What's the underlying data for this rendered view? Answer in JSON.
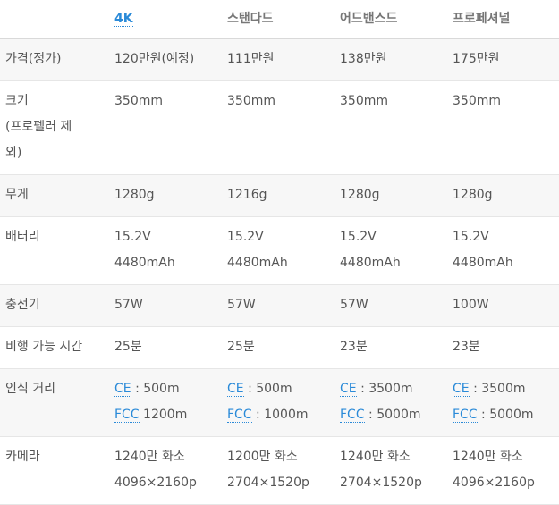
{
  "header": {
    "blank": "",
    "col1": "4K",
    "col2": "스탠다드",
    "col3": "어드밴스드",
    "col4": "프로페셔널"
  },
  "rows": {
    "price": {
      "label": "가격(정가)",
      "v1": "120만원(예정)",
      "v2": "111만원",
      "v3": "138만원",
      "v4": "175만원"
    },
    "size": {
      "label_line1": "크기",
      "label_line2": "(프로펠러 제",
      "label_line3": "외)",
      "v1": "350mm",
      "v2": "350mm",
      "v3": "350mm",
      "v4": "350mm"
    },
    "weight": {
      "label": "무게",
      "v1": "1280g",
      "v2": "1216g",
      "v3": "1280g",
      "v4": "1280g"
    },
    "battery": {
      "label": "배터리",
      "v1_line1": "15.2V",
      "v1_line2": "4480mAh",
      "v2_line1": "15.2V",
      "v2_line2": "4480mAh",
      "v3_line1": "15.2V",
      "v3_line2": "4480mAh",
      "v4_line1": "15.2V",
      "v4_line2": "4480mAh"
    },
    "charger": {
      "label": "충전기",
      "v1": "57W",
      "v2": "57W",
      "v3": "57W",
      "v4": "100W"
    },
    "flight_time": {
      "label": "비행 가능 시간",
      "v1": "25분",
      "v2": "25분",
      "v3": "23분",
      "v4": "23분"
    },
    "range": {
      "label": "인식 거리",
      "ce_link": "CE",
      "fcc_link": "FCC",
      "v1_ce": " : 500m",
      "v1_fcc": " 1200m",
      "v2_ce": " : 500m",
      "v2_fcc": " : 1000m",
      "v3_ce": " : 3500m",
      "v3_fcc": " : 5000m",
      "v4_ce": " : 3500m",
      "v4_fcc": " : 5000m"
    },
    "camera": {
      "label": "카메라",
      "v1_line1": "1240만 화소",
      "v1_line2": "4096×2160p",
      "v2_line1": "1200만 화소",
      "v2_line2": "2704×1520p",
      "v3_line1": "1240만 화소",
      "v3_line2": "2704×1520p",
      "v4_line1": "1240만 화소",
      "v4_line2": "4096×2160p"
    }
  }
}
